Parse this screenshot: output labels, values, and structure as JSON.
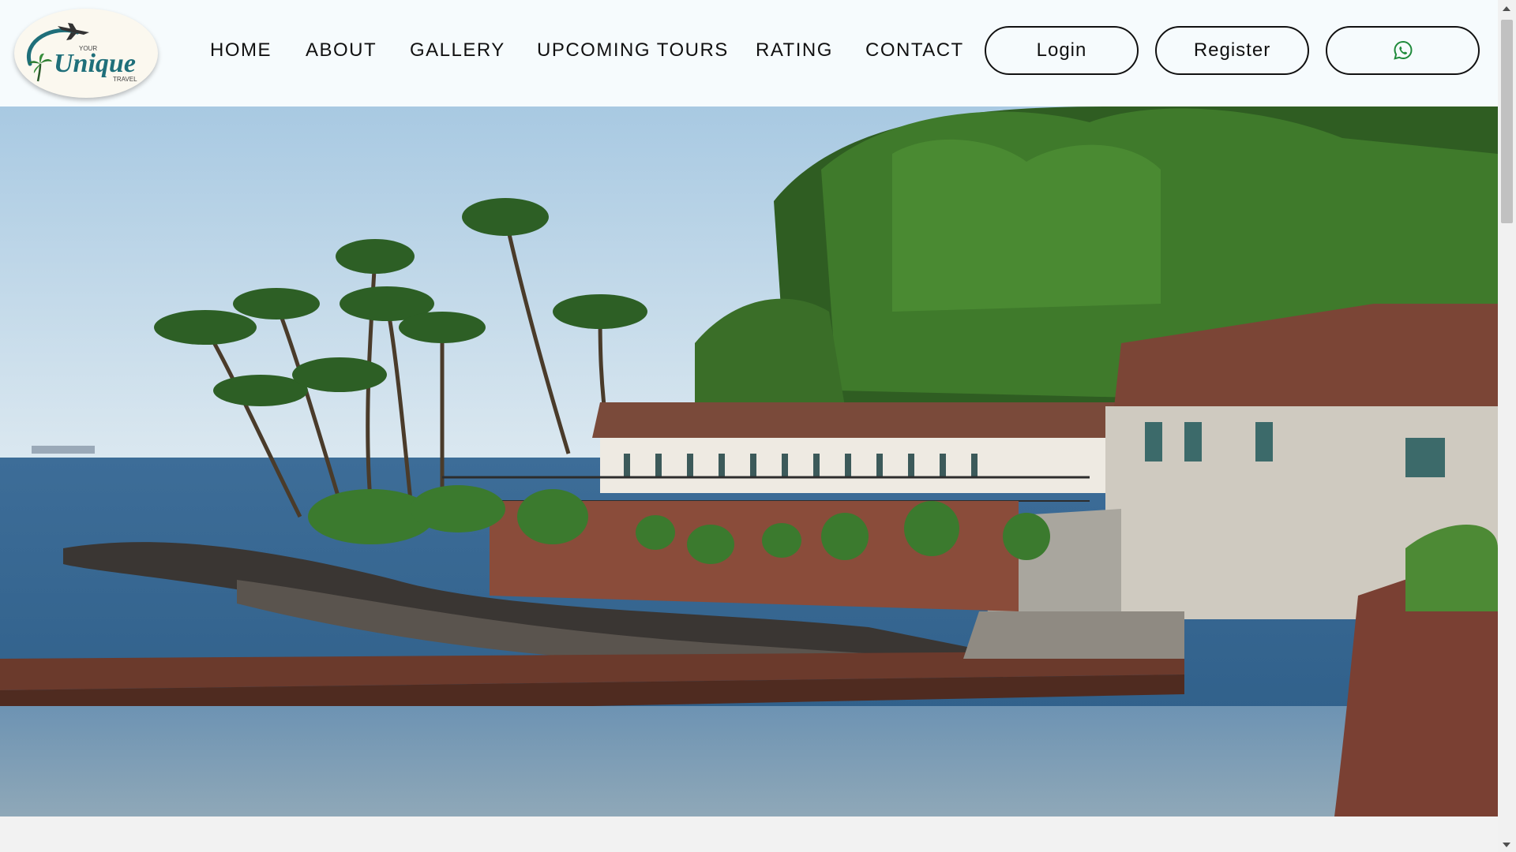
{
  "brand": {
    "logo_text_top": "YOUR",
    "logo_text_main": "Unique",
    "logo_text_bottom": "TRAVEL"
  },
  "nav": {
    "home": "HOME",
    "about": "ABOUT",
    "gallery": "GALLERY",
    "upcoming_tours": "UPCOMING TOURS",
    "rating": "RATING",
    "contact": "CONTACT"
  },
  "auth": {
    "login": "Login",
    "register": "Register"
  },
  "icons": {
    "whatsapp": "whatsapp-icon",
    "logo_plane": "airplane-icon",
    "logo_palm": "palm-tree-icon"
  },
  "colors": {
    "header_bg": "#f6fbfd",
    "text": "#111111",
    "whatsapp_green": "#1f8a3b",
    "logo_teal": "#1f6f7a"
  }
}
